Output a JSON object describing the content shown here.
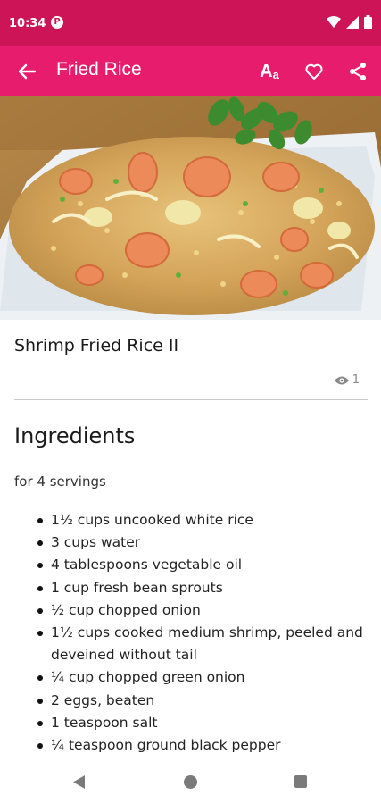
{
  "status_bar": {
    "time": "10:34",
    "app_icon": "P",
    "icons": [
      "wifi-icon",
      "signal-icon",
      "battery-icon"
    ]
  },
  "toolbar": {
    "title": "Fried Rice",
    "font_label_big": "A",
    "font_label_small": "a",
    "icons": [
      "back-arrow-icon",
      "text-size-icon",
      "heart-icon",
      "share-icon"
    ]
  },
  "recipe": {
    "title": "Shrimp Fried Rice II",
    "view_count": "1",
    "ingredients_heading": "Ingredients",
    "servings": "for 4 servings",
    "ingredients": [
      "1½ cups uncooked white rice",
      "3 cups water",
      "4 tablespoons vegetable oil",
      "1 cup fresh bean sprouts",
      "½ cup chopped onion",
      "1½ cups cooked medium shrimp, peeled and deveined without tail",
      "¼ cup chopped green onion",
      "2 eggs, beaten",
      "1 teaspoon salt",
      "¼ teaspoon ground black pepper"
    ]
  },
  "colors": {
    "status_bar": "#cc1457",
    "toolbar": "#e81c6d",
    "text": "#1a1a1a"
  }
}
